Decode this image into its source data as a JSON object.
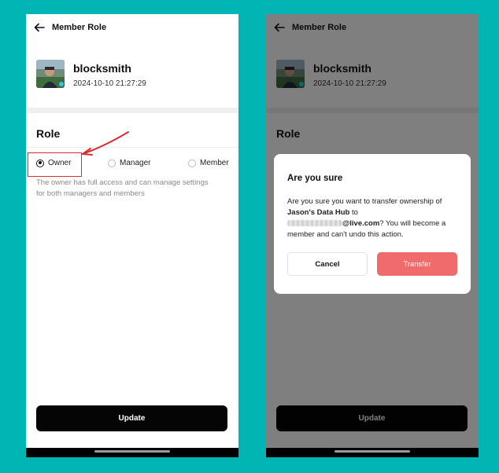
{
  "left_screen": {
    "header": {
      "title": "Member Role"
    },
    "profile": {
      "username": "blocksmith",
      "timestamp": "2024-10-10 21:27:29"
    },
    "role_section": {
      "title": "Role",
      "options": [
        {
          "label": "Owner",
          "selected": true
        },
        {
          "label": "Manager",
          "selected": false
        },
        {
          "label": "Member",
          "selected": false
        }
      ],
      "description": "The owner has full access and can manage settings for both managers and members"
    },
    "update_button": {
      "label": "Update"
    }
  },
  "right_screen": {
    "header": {
      "title": "Member Role"
    },
    "profile": {
      "username": "blocksmith",
      "timestamp": "2024-10-10 21:27:29"
    },
    "role_section": {
      "title": "Role"
    },
    "update_button": {
      "label": "Update"
    },
    "dialog": {
      "title": "Are you sure",
      "body_prefix": "Are you sure you want to transfer ownership of",
      "hub_name": "Jason's Data Hub",
      "body_to": "to",
      "email_domain": "@live.com",
      "body_suffix": "? You will become a member and can't undo this action.",
      "cancel_label": "Cancel",
      "transfer_label": "Transfer"
    }
  },
  "colors": {
    "background": "#00b5b3",
    "annotation_red": "#d62f2f",
    "transfer_button": "#f06b6b",
    "primary_button": "#050505"
  },
  "icons": [
    "back-arrow-icon",
    "avatar-image"
  ]
}
